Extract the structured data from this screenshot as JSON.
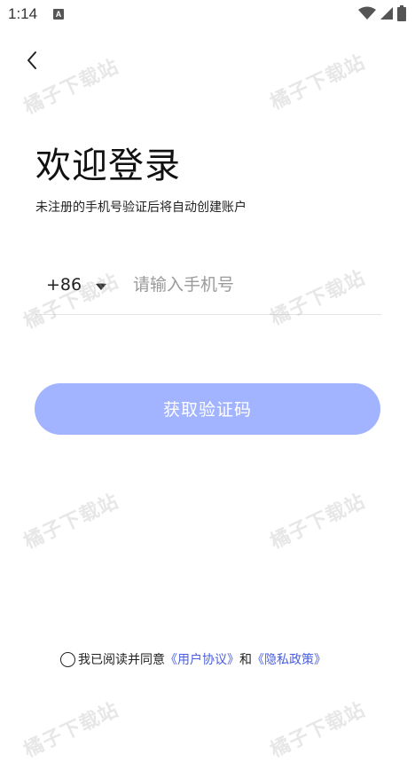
{
  "status_bar": {
    "time": "1:14",
    "notification_badge": "A",
    "icons": [
      "wifi-icon",
      "signal-icon",
      "battery-icon"
    ]
  },
  "login": {
    "title": "欢迎登录",
    "subtitle": "未注册的手机号验证后将自动创建账户",
    "country_code": "+86",
    "phone_placeholder": "请输入手机号",
    "phone_value": "",
    "get_code_label": "获取验证码"
  },
  "agreement": {
    "prefix": "我已阅读并同意",
    "user_agreement": "《用户协议》",
    "connector": "和",
    "privacy_policy": "《隐私政策》",
    "checked": false
  },
  "watermark": {
    "text": "橘子下载站"
  },
  "colors": {
    "button_bg": "#a2b3ff",
    "link": "#4a5fe0",
    "divider": "#e4e4e4"
  }
}
